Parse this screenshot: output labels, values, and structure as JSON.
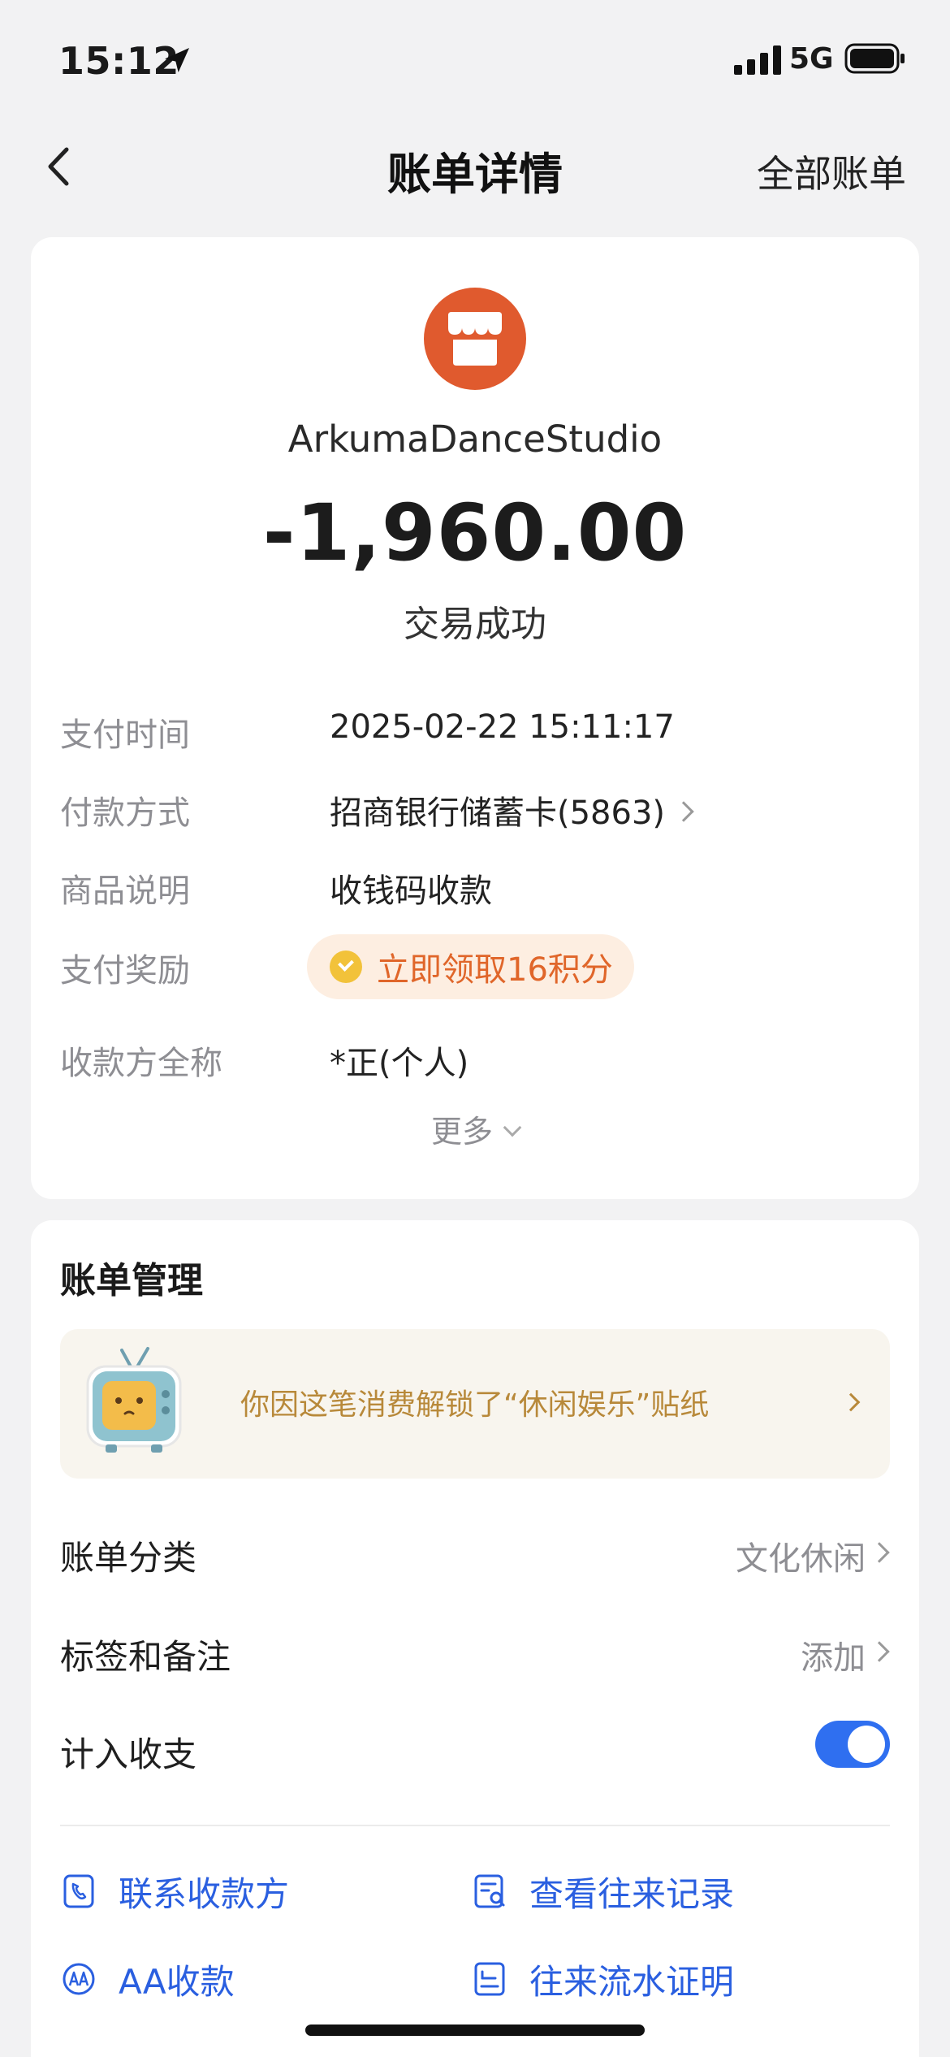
{
  "status_bar": {
    "time": "15:12",
    "network": "5G"
  },
  "nav": {
    "title": "账单详情",
    "right_action": "全部账单"
  },
  "transaction": {
    "merchant": "ArkumaDanceStudio",
    "amount": "-1,960.00",
    "status": "交易成功",
    "details": [
      {
        "label": "支付时间",
        "value": "2025-02-22 15:11:17"
      },
      {
        "label": "付款方式",
        "value": "招商银行储蓄卡(5863)"
      },
      {
        "label": "商品说明",
        "value": "收钱码收款"
      },
      {
        "label": "支付奖励",
        "value": "立即领取16积分"
      },
      {
        "label": "收款方全称",
        "value": "*正(个人)"
      }
    ],
    "more_label": "更多"
  },
  "manage": {
    "title": "账单管理",
    "sticker_text": "你因这笔消费解锁了“休闲娱乐”贴纸",
    "rows": [
      {
        "label": "账单分类",
        "value": "文化休闲"
      },
      {
        "label": "标签和备注",
        "value": "添加"
      },
      {
        "label": "计入收支",
        "value": ""
      }
    ],
    "toggle_on": true,
    "actions": [
      {
        "label": "联系收款方",
        "icon": "phone-icon"
      },
      {
        "label": "查看往来记录",
        "icon": "records-icon"
      },
      {
        "label": "AA收款",
        "icon": "aa-icon"
      },
      {
        "label": "往来流水证明",
        "icon": "certificate-icon"
      }
    ]
  },
  "colors": {
    "accent": "#2f6ff0",
    "merchant_avatar": "#e05a2e",
    "reward": "#e0662a",
    "sticker_text": "#b8893a"
  }
}
